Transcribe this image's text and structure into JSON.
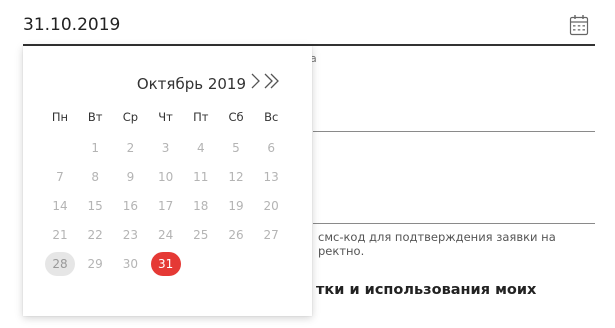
{
  "date_field": {
    "value": "31.10.2019",
    "icon": "calendar-icon"
  },
  "background": {
    "hint_fragment": "а",
    "sms_text_line1": "смс-код для подтверждения заявки на",
    "sms_text_line2": "ректно.",
    "consent_fragment": "тки и использования моих"
  },
  "calendar": {
    "month_label": "Октябрь 2019",
    "next_month_icon": "chevron-right-icon",
    "next_year_icon": "double-chevron-right-icon",
    "weekdays": [
      "Пн",
      "Вт",
      "Ср",
      "Чт",
      "Пт",
      "Сб",
      "Вс"
    ],
    "weeks": [
      [
        "",
        "1",
        "2",
        "3",
        "4",
        "5",
        "6"
      ],
      [
        "7",
        "8",
        "9",
        "10",
        "11",
        "12",
        "13"
      ],
      [
        "14",
        "15",
        "16",
        "17",
        "18",
        "19",
        "20"
      ],
      [
        "21",
        "22",
        "23",
        "24",
        "25",
        "26",
        "27"
      ],
      [
        "28",
        "29",
        "30",
        "31",
        "",
        "",
        ""
      ]
    ],
    "today": "28",
    "selected": "31",
    "colors": {
      "selected": "#e53935",
      "today": "#e6e6e6",
      "muted_day": "#b4b4b4"
    }
  }
}
